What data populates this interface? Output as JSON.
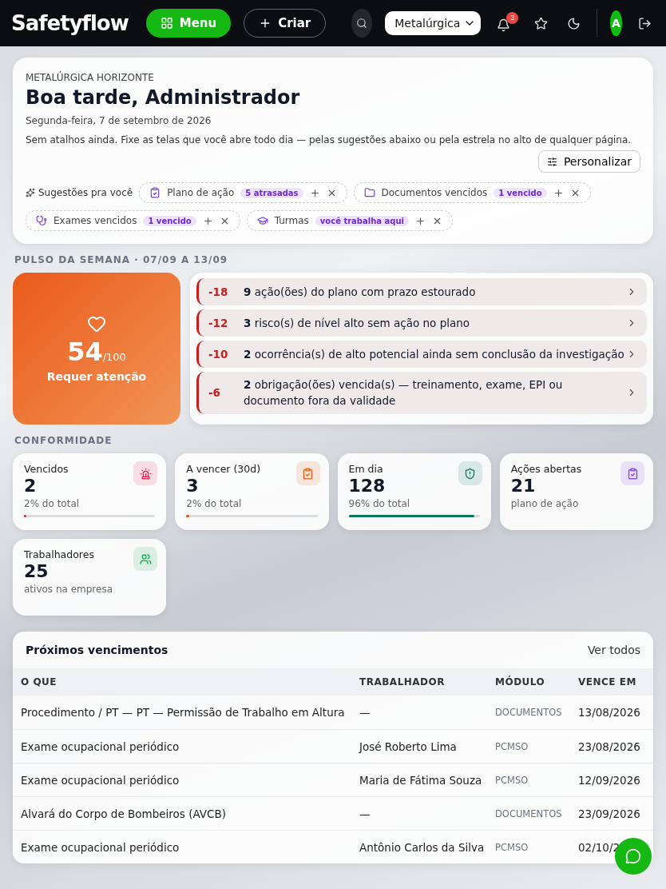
{
  "header": {
    "logo": "Safetyflow",
    "menu_button": "Menu",
    "create_button": "Criar",
    "company_select": "Metalúrgica",
    "notifications_badge": "3",
    "avatar": "A"
  },
  "welcome": {
    "company": "METALÚRGICA HORIZONTE",
    "greeting": "Boa tarde, Administrador",
    "date": "Segunda-feira, 7 de setembro de 2026",
    "hint": "Sem atalhos ainda. Fixe as telas que você abre todo dia — pelas sugestões abaixo ou pela estrela no alto de qualquer página.",
    "customize_button": "Personalizar",
    "suggestions_label": "Sugestões pra você",
    "suggestions": [
      {
        "kind": "clipboard",
        "label": "Plano de ação",
        "badge": "5 atrasadas"
      },
      {
        "kind": "folder",
        "label": "Documentos vencidos",
        "badge": "1 vencido"
      },
      {
        "kind": "stethoscope",
        "label": "Exames vencidos",
        "badge": "1 vencido"
      },
      {
        "kind": "graduation",
        "label": "Turmas",
        "badge": "você trabalha aqui"
      }
    ]
  },
  "pulse": {
    "title": "PULSO DA SEMANA · 07/09 A 13/09",
    "score": "54",
    "score_max": "/100",
    "status": "Requer atenção",
    "issues": [
      {
        "points": "-18",
        "text": "**9** ação(ões) do plano com prazo estourado"
      },
      {
        "points": "-12",
        "text": "**3** risco(s) de nível alto sem ação no plano"
      },
      {
        "points": "-10",
        "text": "**2** ocorrência(s) de alto potencial ainda sem conclusão da investigação"
      },
      {
        "points": "-6",
        "text": "**2** obrigação(ões) vencida(s) — treinamento, exame, EPI ou documento fora da validade"
      }
    ]
  },
  "compliance": {
    "title": "CONFORMIDADE",
    "cards": [
      {
        "kind": "siren",
        "color": "#e11d48",
        "label": "Vencidos",
        "value": "2",
        "note": "2% do total",
        "level": 0.02
      },
      {
        "kind": "clipboard",
        "color": "#ea580c",
        "label": "A vencer (30d)",
        "value": "3",
        "note": "2% do total",
        "level": 0.02
      },
      {
        "kind": "shield",
        "color": "#047857",
        "label": "Em dia",
        "value": "128",
        "note": "96% do total",
        "level": 0.96
      },
      {
        "kind": "clipboard",
        "color": "#7c3aed",
        "label": "Ações abertas",
        "value": "21",
        "note": "plano de ação"
      },
      {
        "kind": "users",
        "color": "#16a34a",
        "label": "Trabalhadores",
        "value": "25",
        "note": "ativos na empresa"
      }
    ]
  },
  "upcoming": {
    "title": "Próximos vencimentos",
    "view_all": "Ver todos",
    "columns": [
      "O QUE",
      "TRABALHADOR",
      "MÓDULO",
      "VENCE EM"
    ],
    "rows": [
      [
        "Procedimento / PT — PT — Permissão de Trabalho em Altura",
        "—",
        "DOCUMENTOS",
        "13/08/2026"
      ],
      [
        "Exame ocupacional periódico",
        "José Roberto Lima",
        "PCMSO",
        "23/08/2026"
      ],
      [
        "Exame ocupacional periódico",
        "Maria de Fátima Souza",
        "PCMSO",
        "12/09/2026"
      ],
      [
        "Alvará do Corpo de Bombeiros (AVCB)",
        "—",
        "DOCUMENTOS",
        "23/09/2026"
      ],
      [
        "Exame ocupacional periódico",
        "Antônio Carlos da Silva",
        "PCMSO",
        "02/10/2"
      ]
    ]
  }
}
